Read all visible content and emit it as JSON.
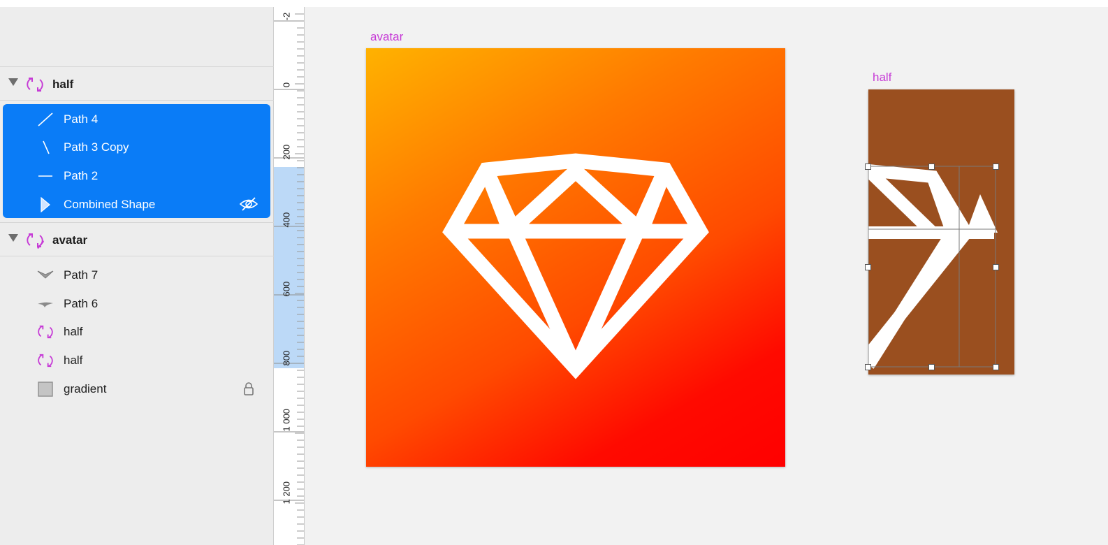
{
  "layers_panel": {
    "groups": [
      {
        "label": "half",
        "icon": "symbol-icon"
      },
      {
        "label": "avatar",
        "icon": "symbol-override-icon"
      }
    ],
    "half_children": [
      {
        "label": "Path 4",
        "icon": "diagonal-line-icon"
      },
      {
        "label": "Path 3 Copy",
        "icon": "backslash-line-icon"
      },
      {
        "label": "Path 2",
        "icon": "horizontal-line-icon"
      },
      {
        "label": "Combined Shape",
        "icon": "combined-shape-icon",
        "trailing_icon": "hidden-eye-icon"
      }
    ],
    "avatar_children": [
      {
        "label": "Path 7",
        "icon": "chevron-path-icon"
      },
      {
        "label": "Path 6",
        "icon": "curve-path-icon"
      },
      {
        "label": "half",
        "icon": "symbol-icon"
      },
      {
        "label": "half",
        "icon": "symbol-icon"
      },
      {
        "label": "gradient",
        "icon": "rectangle-icon",
        "trailing_icon": "lock-icon"
      }
    ]
  },
  "ruler": {
    "labels": [
      "-2",
      "0",
      "200",
      "400",
      "600",
      "800",
      "1 000",
      "1 200"
    ]
  },
  "canvas": {
    "artboards": [
      {
        "label": "avatar"
      },
      {
        "label": "half"
      }
    ]
  },
  "colors": {
    "selection": "#0a7cf7",
    "symbol_accent": "#c63ad6",
    "half_background": "#9a4f1f"
  }
}
